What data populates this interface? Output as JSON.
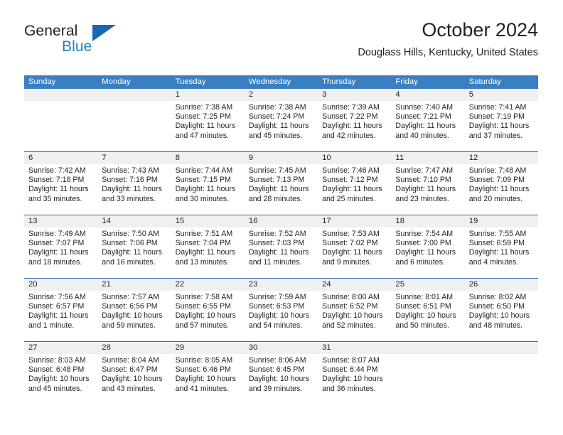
{
  "brand": {
    "name_top": "General",
    "name_bottom": "Blue",
    "accent_color": "#1668b3",
    "text_color": "#231f20"
  },
  "header": {
    "title": "October 2024",
    "subtitle": "Douglass Hills, Kentucky, United States"
  },
  "theme": {
    "header_row_bg": "#3a7fc1",
    "week_rule": "#2e6ca8",
    "day_band_bg": "#f0f0f0",
    "text": "#231f20"
  },
  "weekdays": [
    "Sunday",
    "Monday",
    "Tuesday",
    "Wednesday",
    "Thursday",
    "Friday",
    "Saturday"
  ],
  "weeks": [
    [
      {
        "day": "",
        "lines": []
      },
      {
        "day": "",
        "lines": []
      },
      {
        "day": "1",
        "lines": [
          "Sunrise: 7:38 AM",
          "Sunset: 7:25 PM",
          "Daylight: 11 hours",
          "and 47 minutes."
        ]
      },
      {
        "day": "2",
        "lines": [
          "Sunrise: 7:38 AM",
          "Sunset: 7:24 PM",
          "Daylight: 11 hours",
          "and 45 minutes."
        ]
      },
      {
        "day": "3",
        "lines": [
          "Sunrise: 7:39 AM",
          "Sunset: 7:22 PM",
          "Daylight: 11 hours",
          "and 42 minutes."
        ]
      },
      {
        "day": "4",
        "lines": [
          "Sunrise: 7:40 AM",
          "Sunset: 7:21 PM",
          "Daylight: 11 hours",
          "and 40 minutes."
        ]
      },
      {
        "day": "5",
        "lines": [
          "Sunrise: 7:41 AM",
          "Sunset: 7:19 PM",
          "Daylight: 11 hours",
          "and 37 minutes."
        ]
      }
    ],
    [
      {
        "day": "6",
        "lines": [
          "Sunrise: 7:42 AM",
          "Sunset: 7:18 PM",
          "Daylight: 11 hours",
          "and 35 minutes."
        ]
      },
      {
        "day": "7",
        "lines": [
          "Sunrise: 7:43 AM",
          "Sunset: 7:16 PM",
          "Daylight: 11 hours",
          "and 33 minutes."
        ]
      },
      {
        "day": "8",
        "lines": [
          "Sunrise: 7:44 AM",
          "Sunset: 7:15 PM",
          "Daylight: 11 hours",
          "and 30 minutes."
        ]
      },
      {
        "day": "9",
        "lines": [
          "Sunrise: 7:45 AM",
          "Sunset: 7:13 PM",
          "Daylight: 11 hours",
          "and 28 minutes."
        ]
      },
      {
        "day": "10",
        "lines": [
          "Sunrise: 7:46 AM",
          "Sunset: 7:12 PM",
          "Daylight: 11 hours",
          "and 25 minutes."
        ]
      },
      {
        "day": "11",
        "lines": [
          "Sunrise: 7:47 AM",
          "Sunset: 7:10 PM",
          "Daylight: 11 hours",
          "and 23 minutes."
        ]
      },
      {
        "day": "12",
        "lines": [
          "Sunrise: 7:48 AM",
          "Sunset: 7:09 PM",
          "Daylight: 11 hours",
          "and 20 minutes."
        ]
      }
    ],
    [
      {
        "day": "13",
        "lines": [
          "Sunrise: 7:49 AM",
          "Sunset: 7:07 PM",
          "Daylight: 11 hours",
          "and 18 minutes."
        ]
      },
      {
        "day": "14",
        "lines": [
          "Sunrise: 7:50 AM",
          "Sunset: 7:06 PM",
          "Daylight: 11 hours",
          "and 16 minutes."
        ]
      },
      {
        "day": "15",
        "lines": [
          "Sunrise: 7:51 AM",
          "Sunset: 7:04 PM",
          "Daylight: 11 hours",
          "and 13 minutes."
        ]
      },
      {
        "day": "16",
        "lines": [
          "Sunrise: 7:52 AM",
          "Sunset: 7:03 PM",
          "Daylight: 11 hours",
          "and 11 minutes."
        ]
      },
      {
        "day": "17",
        "lines": [
          "Sunrise: 7:53 AM",
          "Sunset: 7:02 PM",
          "Daylight: 11 hours",
          "and 9 minutes."
        ]
      },
      {
        "day": "18",
        "lines": [
          "Sunrise: 7:54 AM",
          "Sunset: 7:00 PM",
          "Daylight: 11 hours",
          "and 6 minutes."
        ]
      },
      {
        "day": "19",
        "lines": [
          "Sunrise: 7:55 AM",
          "Sunset: 6:59 PM",
          "Daylight: 11 hours",
          "and 4 minutes."
        ]
      }
    ],
    [
      {
        "day": "20",
        "lines": [
          "Sunrise: 7:56 AM",
          "Sunset: 6:57 PM",
          "Daylight: 11 hours",
          "and 1 minute."
        ]
      },
      {
        "day": "21",
        "lines": [
          "Sunrise: 7:57 AM",
          "Sunset: 6:56 PM",
          "Daylight: 10 hours",
          "and 59 minutes."
        ]
      },
      {
        "day": "22",
        "lines": [
          "Sunrise: 7:58 AM",
          "Sunset: 6:55 PM",
          "Daylight: 10 hours",
          "and 57 minutes."
        ]
      },
      {
        "day": "23",
        "lines": [
          "Sunrise: 7:59 AM",
          "Sunset: 6:53 PM",
          "Daylight: 10 hours",
          "and 54 minutes."
        ]
      },
      {
        "day": "24",
        "lines": [
          "Sunrise: 8:00 AM",
          "Sunset: 6:52 PM",
          "Daylight: 10 hours",
          "and 52 minutes."
        ]
      },
      {
        "day": "25",
        "lines": [
          "Sunrise: 8:01 AM",
          "Sunset: 6:51 PM",
          "Daylight: 10 hours",
          "and 50 minutes."
        ]
      },
      {
        "day": "26",
        "lines": [
          "Sunrise: 8:02 AM",
          "Sunset: 6:50 PM",
          "Daylight: 10 hours",
          "and 48 minutes."
        ]
      }
    ],
    [
      {
        "day": "27",
        "lines": [
          "Sunrise: 8:03 AM",
          "Sunset: 6:48 PM",
          "Daylight: 10 hours",
          "and 45 minutes."
        ]
      },
      {
        "day": "28",
        "lines": [
          "Sunrise: 8:04 AM",
          "Sunset: 6:47 PM",
          "Daylight: 10 hours",
          "and 43 minutes."
        ]
      },
      {
        "day": "29",
        "lines": [
          "Sunrise: 8:05 AM",
          "Sunset: 6:46 PM",
          "Daylight: 10 hours",
          "and 41 minutes."
        ]
      },
      {
        "day": "30",
        "lines": [
          "Sunrise: 8:06 AM",
          "Sunset: 6:45 PM",
          "Daylight: 10 hours",
          "and 39 minutes."
        ]
      },
      {
        "day": "31",
        "lines": [
          "Sunrise: 8:07 AM",
          "Sunset: 6:44 PM",
          "Daylight: 10 hours",
          "and 36 minutes."
        ]
      },
      {
        "day": "",
        "lines": []
      },
      {
        "day": "",
        "lines": []
      }
    ]
  ]
}
